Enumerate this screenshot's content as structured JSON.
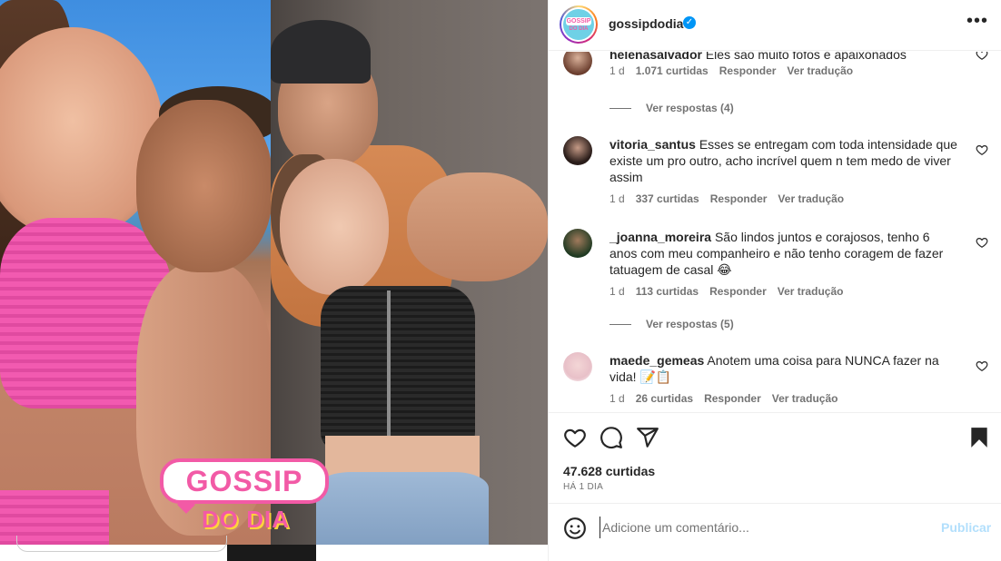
{
  "post": {
    "username": "gossipdodia",
    "verified": true,
    "more_label": "•••",
    "avatar_text_top": "GOSSIP",
    "avatar_text_bottom": "DO DIA"
  },
  "media": {
    "overlay_logo_line1": "GOSSIP",
    "overlay_logo_line2": "DO DIA"
  },
  "comments": [
    {
      "user": "helenasalvador",
      "text": "Eles são muito fofos e apaixonados",
      "time": "1 d",
      "likes": "1.071 curtidas",
      "reply_label": "Responder",
      "translate_label": "Ver tradução",
      "view_replies": "Ver respostas (4)"
    },
    {
      "user": "vitoria_santus",
      "text": "Esses se entregam com toda intensidade que existe um pro outro, acho incrível quem n tem medo de viver assim",
      "time": "1 d",
      "likes": "337 curtidas",
      "reply_label": "Responder",
      "translate_label": "Ver tradução"
    },
    {
      "user": "_joanna_moreira",
      "text": "São lindos juntos e corajosos, tenho 6 anos com meu companheiro e não tenho coragem de fazer tatuagem de casal 😂",
      "time": "1 d",
      "likes": "113 curtidas",
      "reply_label": "Responder",
      "translate_label": "Ver tradução",
      "view_replies": "Ver respostas (5)"
    },
    {
      "user": "maede_gemeas",
      "text": "Anotem uma coisa para NUNCA fazer na vida! 📝📋",
      "time": "1 d",
      "likes": "26 curtidas",
      "reply_label": "Responder",
      "translate_label": "Ver tradução"
    }
  ],
  "stats": {
    "likes": "47.628 curtidas",
    "time_ago": "HÁ 1 DIA"
  },
  "composer": {
    "placeholder": "Adicione um comentário...",
    "publish_label": "Publicar"
  },
  "icons": {
    "like": "heart-icon",
    "comment": "comment-icon",
    "share": "share-icon",
    "save": "bookmark-icon",
    "emoji": "emoji-icon",
    "more": "more-icon"
  },
  "colors": {
    "verified_blue": "#0095f6",
    "publish_disabled": "#b2dffc",
    "brand_pink": "#f25aa6",
    "brand_yellow": "#ffd43b",
    "text_primary": "#262626",
    "text_secondary": "#737373"
  }
}
